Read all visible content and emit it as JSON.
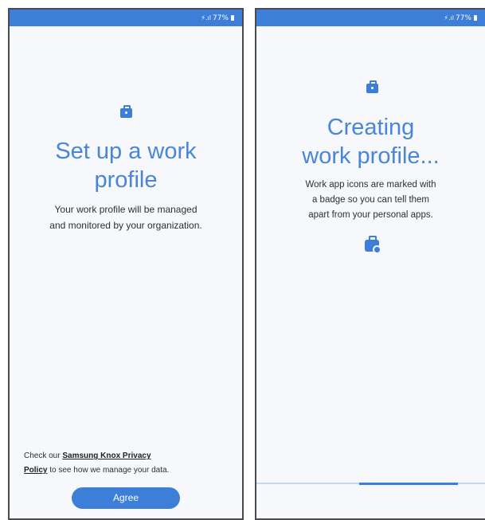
{
  "left_screen": {
    "status": {
      "signal_label": "⚡.ıl",
      "battery": "77%"
    },
    "title_line1": "Set up a work",
    "title_line2": "profile",
    "body_line1": "Your work profile will be managed",
    "body_line2": "and monitored by your organization.",
    "privacy_prefix": "Check our ",
    "privacy_link_line1": "Samsung Knox Privacy",
    "privacy_link_line2": "Policy",
    "privacy_suffix": " to see how we manage your data.",
    "agree_label": "Agree"
  },
  "right_screen": {
    "status": {
      "signal_label": "⚡.ıl",
      "battery": "77%"
    },
    "title_line1": "Creating",
    "title_line2": "work profile...",
    "body_line1": "Work app icons are marked with",
    "body_line2": "a badge so you can tell them",
    "body_line3": "apart from your personal apps.",
    "progress": {
      "start": 0.45,
      "end": 0.88
    }
  },
  "colors": {
    "accent": "#3c7ed8",
    "title": "#4a86d8",
    "background": "#f6f8fb"
  },
  "icons": [
    "briefcase-icon",
    "work-badge-icon",
    "wifi-icon",
    "battery-icon"
  ]
}
